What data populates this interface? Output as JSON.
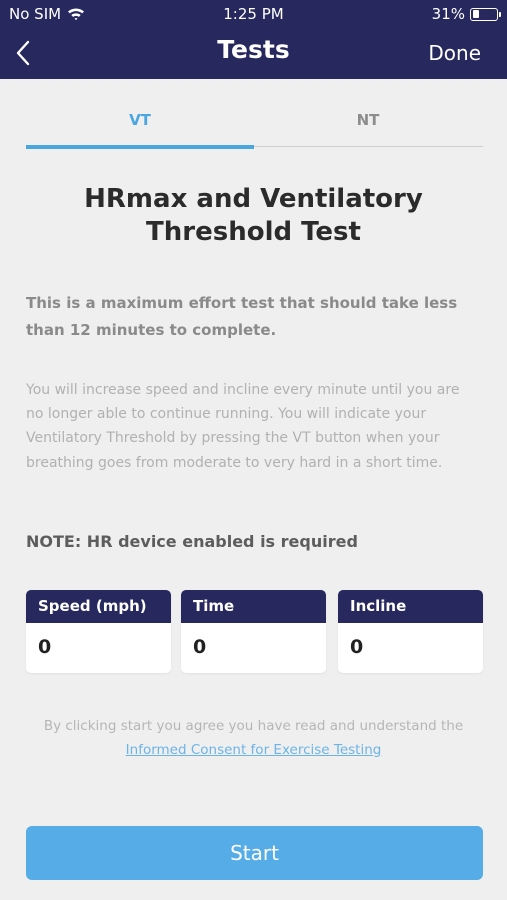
{
  "status_bar": {
    "carrier": "No SIM",
    "time": "1:25 PM",
    "battery": "31%",
    "battery_level": 0.31,
    "wifi_icon": "wifi-icon"
  },
  "nav": {
    "title": "Tests",
    "done_label": "Done",
    "back_icon": "chevron-left-icon"
  },
  "tabs": [
    {
      "label": "VT",
      "active": true
    },
    {
      "label": "NT",
      "active": false
    }
  ],
  "test": {
    "title": "HRmax and Ventilatory Threshold Test",
    "lead": "This is a maximum effort test that should take less than 12 minutes to complete.",
    "body": "You will increase speed and incline every minute until you are no longer able to continue running.  You will indicate your Ventilatory Threshold by pressing the VT button when your breathing goes from moderate to very hard in a short time.",
    "note": "NOTE: HR device enabled is required"
  },
  "stats": [
    {
      "label": "Speed (mph)",
      "value": "0"
    },
    {
      "label": "Time",
      "value": "0"
    },
    {
      "label": "Incline",
      "value": "0"
    }
  ],
  "consent": {
    "text": "By clicking start you agree you have read and understand the",
    "link": "Informed Consent for Exercise Testing"
  },
  "start_label": "Start",
  "colors": {
    "header": "#27285e",
    "accent": "#4aa6e0",
    "start_button": "#55ace6",
    "background": "#efefef"
  }
}
